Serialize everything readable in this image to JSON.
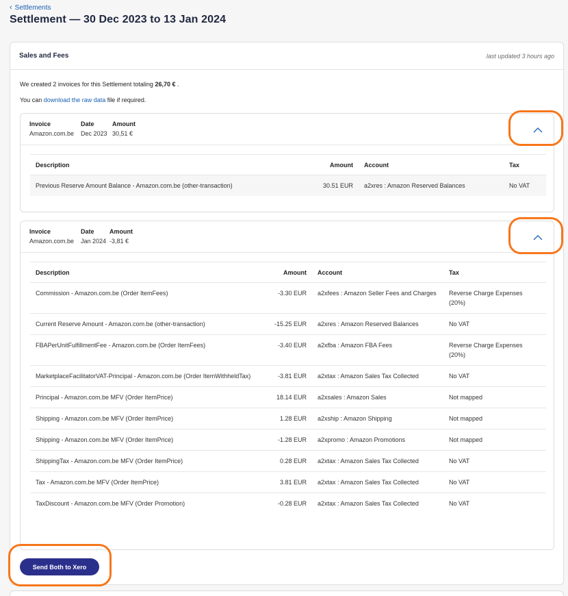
{
  "breadcrumb": {
    "label": "Settlements"
  },
  "page": {
    "title": "Settlement — 30 Dec 2023 to 13 Jan 2024"
  },
  "card": {
    "title": "Sales and Fees",
    "last_updated": "last updated 3 hours ago"
  },
  "summary": {
    "line1_prefix": "We created 2 invoices for this Settlement totaling",
    "total": "26,70 €",
    "line1_suffix": ".",
    "line2_prefix": "You can",
    "download_link": "download the raw data",
    "line2_suffix": "file if required."
  },
  "invoices": [
    {
      "labels": {
        "invoice": "Invoice",
        "date": "Date",
        "amount": "Amount"
      },
      "invoice": "Amazon.com.be",
      "date": "Dec 2023",
      "amount": "30,51 €",
      "columns": [
        "Description",
        "Amount",
        "Account",
        "Tax"
      ],
      "lines": [
        {
          "description": "Previous Reserve Amount Balance - Amazon.com.be (other-transaction)",
          "amount": "30.51 EUR",
          "account": "a2xres : Amazon Reserved Balances",
          "tax": "No VAT"
        }
      ]
    },
    {
      "labels": {
        "invoice": "Invoice",
        "date": "Date",
        "amount": "Amount"
      },
      "invoice": "Amazon.com.be",
      "date": "Jan 2024",
      "amount": "-3,81 €",
      "columns": [
        "Description",
        "Amount",
        "Account",
        "Tax"
      ],
      "lines": [
        {
          "description": "Commission - Amazon.com.be (Order ItemFees)",
          "amount": "-3.30 EUR",
          "account": "a2xfees : Amazon Seller Fees and Charges",
          "tax": "Reverse Charge Expenses (20%)"
        },
        {
          "description": "Current Reserve Amount - Amazon.com.be (other-transaction)",
          "amount": "-15.25 EUR",
          "account": "a2xres : Amazon Reserved Balances",
          "tax": "No VAT"
        },
        {
          "description": "FBAPerUnitFulfillmentFee - Amazon.com.be (Order ItemFees)",
          "amount": "-3.40 EUR",
          "account": "a2xfba : Amazon FBA Fees",
          "tax": "Reverse Charge Expenses (20%)"
        },
        {
          "description": "MarketplaceFacilitatorVAT-Principal - Amazon.com.be (Order ItemWithheldTax)",
          "amount": "-3.81 EUR",
          "account": "a2xtax : Amazon Sales Tax Collected",
          "tax": "No VAT"
        },
        {
          "description": "Principal - Amazon.com.be MFV (Order ItemPrice)",
          "amount": "18.14 EUR",
          "account": "a2xsales : Amazon Sales",
          "tax": "Not mapped"
        },
        {
          "description": "Shipping - Amazon.com.be  MFV (Order ItemPrice)",
          "amount": "1.28 EUR",
          "account": "a2xship : Amazon Shipping",
          "tax": "Not mapped"
        },
        {
          "description": "Shipping - Amazon.com.be  MFV (Order ItemPrice)",
          "amount": "-1.28 EUR",
          "account": "a2xpromo : Amazon Promotions",
          "tax": "Not mapped"
        },
        {
          "description": "ShippingTax - Amazon.com.be  MFV (Order ItemPrice)",
          "amount": "0.28 EUR",
          "account": "a2xtax : Amazon Sales Tax Collected",
          "tax": "No VAT"
        },
        {
          "description": "Tax - Amazon.com.be MFV (Order ItemPrice)",
          "amount": "3.81 EUR",
          "account": "a2xtax : Amazon Sales Tax Collected",
          "tax": "No VAT"
        },
        {
          "description": "TaxDiscount - Amazon.com.be MFV (Order Promotion)",
          "amount": "-0.28 EUR",
          "account": "a2xtax : Amazon Sales Tax Collected",
          "tax": "No VAT"
        }
      ]
    }
  ],
  "actions": {
    "send_label": "Send Both to Xero"
  },
  "colors": {
    "accent": "#1a5fb4",
    "button": "#2b2f8c",
    "highlight": "#f7761a"
  },
  "icons": {
    "breadcrumb": "chevron-left-icon",
    "collapse": "chevron-up-icon"
  }
}
